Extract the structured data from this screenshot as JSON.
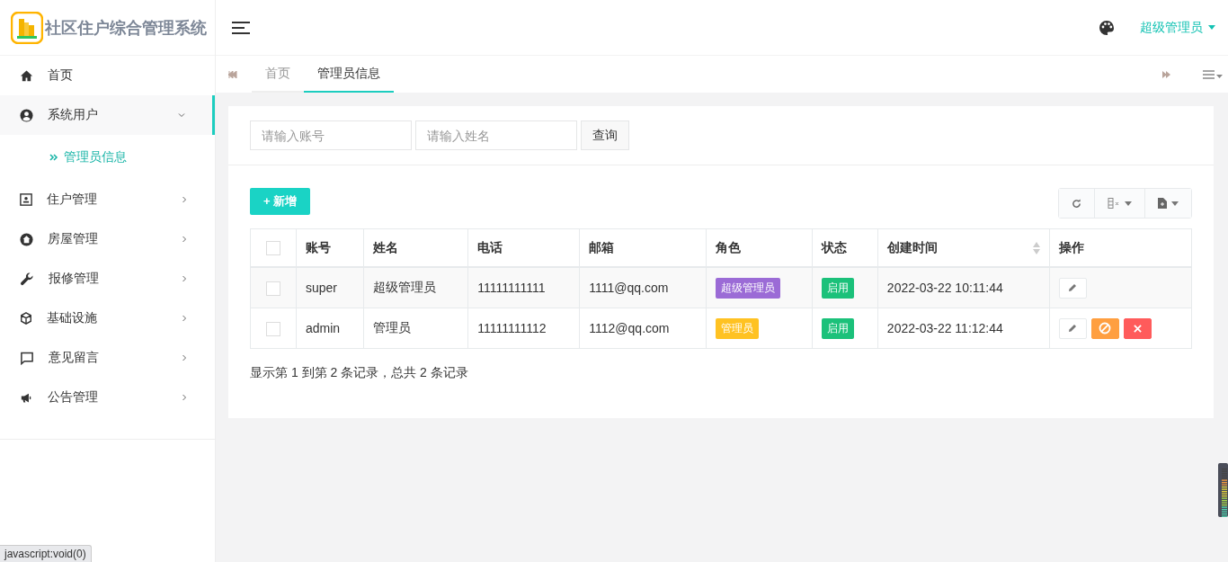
{
  "brand": {
    "title": "社区住户综合管理系统"
  },
  "header": {
    "user": "超级管理员"
  },
  "sidebar": {
    "items": [
      {
        "label": "首页",
        "expanded": false,
        "has_children": false
      },
      {
        "label": "系统用户",
        "expanded": true,
        "has_children": true,
        "children": [
          {
            "label": "管理员信息",
            "selected": true
          }
        ]
      },
      {
        "label": "住户管理",
        "expanded": false,
        "has_children": true
      },
      {
        "label": "房屋管理",
        "expanded": false,
        "has_children": true
      },
      {
        "label": "报修管理",
        "expanded": false,
        "has_children": true
      },
      {
        "label": "基础设施",
        "expanded": false,
        "has_children": true
      },
      {
        "label": "意见留言",
        "expanded": false,
        "has_children": true
      },
      {
        "label": "公告管理",
        "expanded": false,
        "has_children": true
      }
    ]
  },
  "tabs": [
    {
      "label": "首页",
      "selected": false
    },
    {
      "label": "管理员信息",
      "selected": true
    }
  ],
  "search": {
    "fields": [
      {
        "placeholder": "请输入账号"
      },
      {
        "placeholder": "请输入姓名"
      }
    ],
    "button": "查询"
  },
  "add_button": "+ 新增",
  "table": {
    "columns": [
      {
        "label": "账号",
        "sortable": false
      },
      {
        "label": "姓名",
        "sortable": false
      },
      {
        "label": "电话",
        "sortable": false
      },
      {
        "label": "邮箱",
        "sortable": false
      },
      {
        "label": "角色",
        "sortable": false
      },
      {
        "label": "状态",
        "sortable": false
      },
      {
        "label": "创建时间",
        "sortable": true
      },
      {
        "label": "操作",
        "sortable": false
      }
    ],
    "header_checked": false,
    "rows": [
      {
        "checked": false,
        "account": "super",
        "name": "超级管理员",
        "phone": "11111111111",
        "email": "1111@qq.com",
        "role": {
          "label": "超级管理员",
          "color": "#9b6bd6"
        },
        "status": "启用",
        "created": "2022-03-22 10:11:44",
        "actions": [
          {
            "kind": "edit"
          }
        ]
      },
      {
        "checked": false,
        "account": "admin",
        "name": "管理员",
        "phone": "11111111112",
        "email": "1112@qq.com",
        "role": {
          "label": "管理员",
          "color": "#ffc222"
        },
        "status": "启用",
        "created": "2022-03-22 11:12:44",
        "actions": [
          {
            "kind": "edit"
          },
          {
            "kind": "disable"
          },
          {
            "kind": "delete"
          }
        ]
      }
    ]
  },
  "pagination": "显示第 1 到第 2 条记录，总共 2 条记录",
  "status_bar": "javascript:void(0)"
}
